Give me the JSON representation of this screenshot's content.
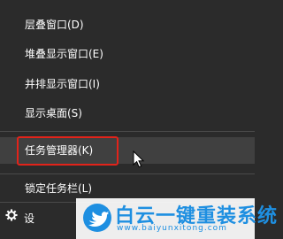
{
  "menu": {
    "items": [
      {
        "label": "层叠窗口(D)"
      },
      {
        "label": "堆叠显示窗口(E)"
      },
      {
        "label": "并排显示窗口(I)"
      },
      {
        "label": "显示桌面(S)"
      },
      {
        "label": "任务管理器(K)"
      },
      {
        "label": "锁定任务栏(L)"
      }
    ],
    "partial_item_fragment": "设"
  },
  "watermark": {
    "title": "白云一键重装系统",
    "url": "www.baiyunxitong.com"
  },
  "colors": {
    "background": "#2b2b2b",
    "hover": "#404040",
    "highlight_border": "#e2231a",
    "watermark_blue": "#1e8fe1"
  }
}
